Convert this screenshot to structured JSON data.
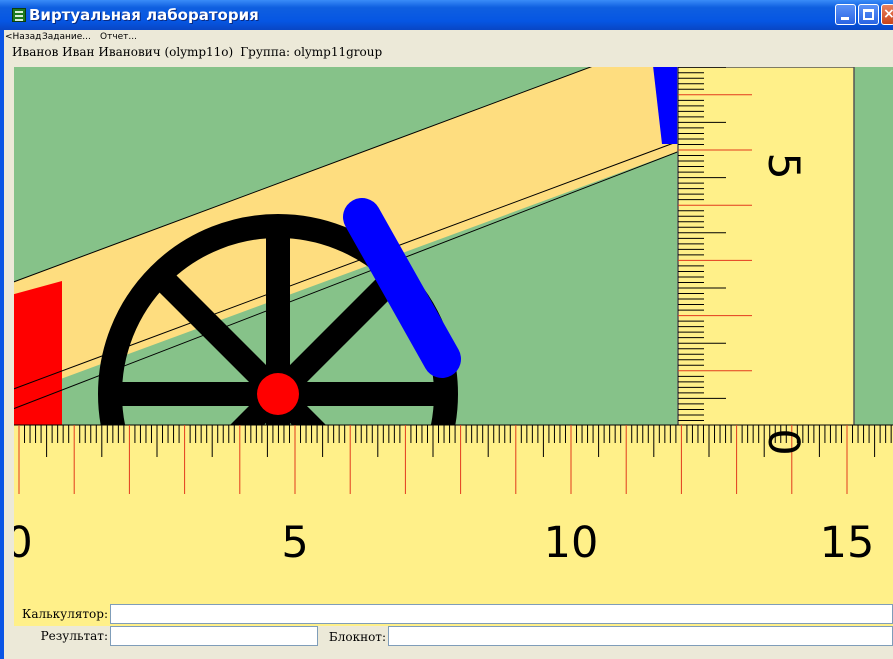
{
  "window": {
    "title": "Виртуальная лаборатория",
    "close_glyph": "×"
  },
  "menu": {
    "items": [
      "<Назад",
      "Задание...",
      "Отчет..."
    ]
  },
  "user": {
    "name": "Иванов Иван Иванович (olymp11o)",
    "group": "Группа: olymp11group"
  },
  "lab": {
    "horizontal_ruler": {
      "labels": [
        "0",
        "5",
        "10",
        "15"
      ],
      "label_values": [
        0,
        5,
        10,
        15
      ],
      "fill": "#fff089",
      "major_color": "#e23a1c"
    },
    "vertical_ruler": {
      "labels": [
        "0",
        "5"
      ],
      "label_values": [
        0,
        5
      ],
      "fill": "#fff089"
    },
    "colors": {
      "background": "#86c289",
      "ramp": "#fedd7f",
      "wheel": "#000000",
      "hub": "#ff0000",
      "pointer": "#0000ff",
      "stop": "#ff0000"
    }
  },
  "footer": {
    "calculator_label": "Калькулятор:",
    "calculator_value": "",
    "result_label": "Результат:",
    "result_value": "",
    "notepad_label": "Блокнот:",
    "notepad_value": ""
  }
}
